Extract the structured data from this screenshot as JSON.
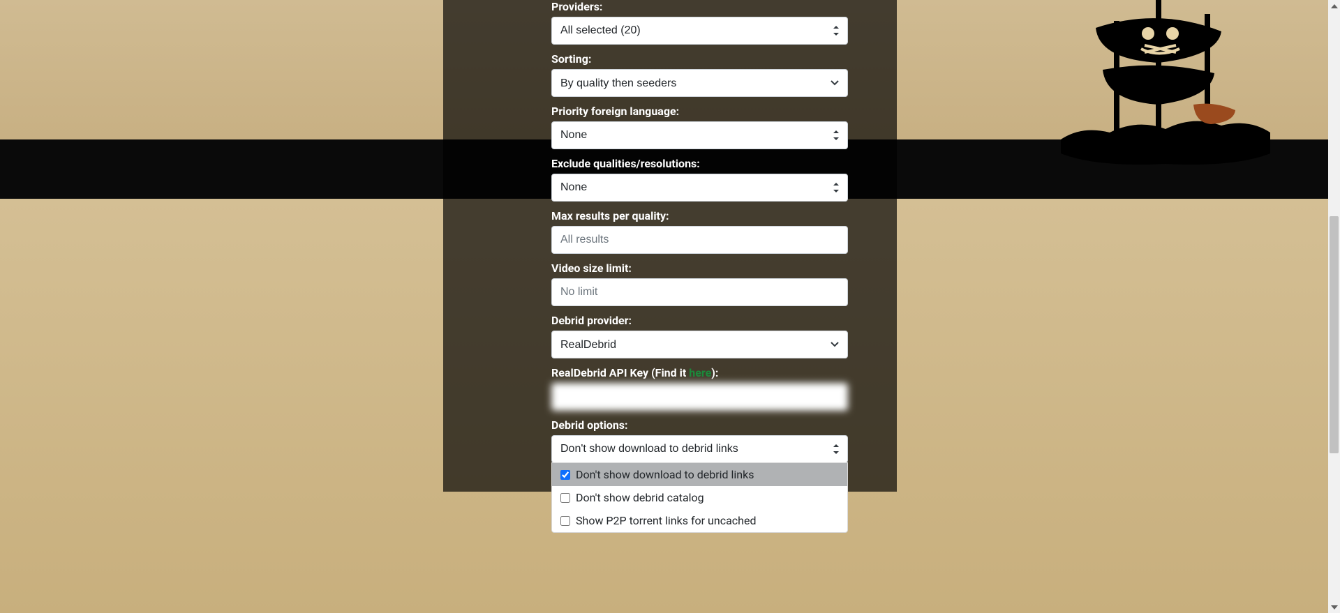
{
  "form": {
    "providers": {
      "label": "Providers:",
      "value": "All selected (20)"
    },
    "sorting": {
      "label": "Sorting:",
      "value": "By quality then seeders"
    },
    "priority_language": {
      "label": "Priority foreign language:",
      "value": "None"
    },
    "exclude_qualities": {
      "label": "Exclude qualities/resolutions:",
      "value": "None"
    },
    "max_results": {
      "label": "Max results per quality:",
      "placeholder": "All results",
      "value": ""
    },
    "video_size": {
      "label": "Video size limit:",
      "placeholder": "No limit",
      "value": ""
    },
    "debrid_provider": {
      "label": "Debrid provider:",
      "value": "RealDebrid"
    },
    "api_key": {
      "label_prefix": "RealDebrid API Key (Find it ",
      "label_link": "here",
      "label_suffix": "):",
      "value": ""
    },
    "debrid_options": {
      "label": "Debrid options:",
      "value": "Don't show download to debrid links",
      "items": [
        {
          "label": "Don't show download to debrid links",
          "checked": true
        },
        {
          "label": "Don't show debrid catalog",
          "checked": false
        },
        {
          "label": "Show P2P torrent links for uncached",
          "checked": false
        }
      ]
    }
  },
  "colors": {
    "link": "#1b8a3b"
  }
}
